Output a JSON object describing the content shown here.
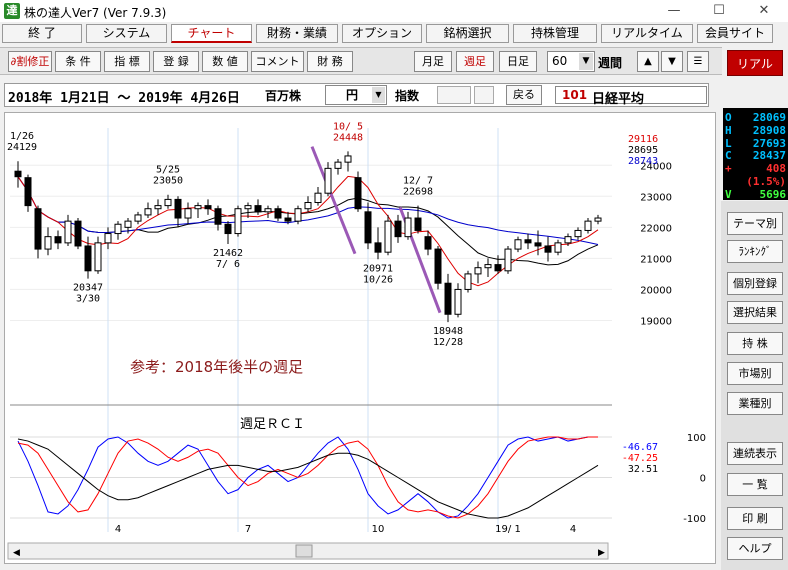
{
  "window": {
    "title": "株の達人Ver7 (Ver 7.9.3)",
    "icon_char": "達",
    "minimize": "—",
    "maximize": "☐",
    "close": "✕"
  },
  "menu": [
    "終 了",
    "システム",
    "チャート",
    "財務・業績",
    "オプション",
    "銘柄選択",
    "持株管理",
    "リアルタイム",
    "会員サイト"
  ],
  "menu_active": 2,
  "toolbar": {
    "left": [
      "∂割修正",
      "条 件",
      "指 標",
      "登 録",
      "数 値",
      "コメント",
      "財 務"
    ],
    "periods": [
      "月足",
      "週足",
      "日足"
    ],
    "period_active": 1,
    "count_value": "60",
    "count_unit": "週間",
    "up": "▲",
    "down": "▼",
    "menu": "☰"
  },
  "daterow": {
    "range": "2018年 1月21日 ～ 2019年 4月26日",
    "unit": "百万株",
    "currency": "円",
    "index_label": "指数",
    "back": "戻る",
    "code": "101",
    "name": "日経平均"
  },
  "right": {
    "real": "リアル",
    "ohlc": [
      {
        "k": "O",
        "v": "28069",
        "c": "#00c0ff"
      },
      {
        "k": "H",
        "v": "28908",
        "c": "#00c0ff"
      },
      {
        "k": "L",
        "v": "27693",
        "c": "#00c0ff"
      },
      {
        "k": "C",
        "v": "28437",
        "c": "#00c0ff"
      },
      {
        "k": "+",
        "v": "408",
        "c": "#ff3030"
      },
      {
        "k": " ",
        "v": "(1.5%)",
        "c": "#ff3030"
      },
      {
        "k": "V",
        "v": "5696",
        "c": "#40ff40"
      }
    ],
    "buttons": [
      "テーマ別",
      "ﾗﾝｷﾝｸﾞ",
      "個別登録",
      "選択結果",
      "持 株",
      "市場別",
      "業種別",
      "連続表示",
      "一 覧",
      "印 刷",
      "ヘルプ"
    ]
  },
  "colors": {
    "up_candle": "#ffffff",
    "down_candle": "#000000",
    "ma_red": "#dd0000",
    "ma_black": "#000000",
    "ma_blue": "#0000cc",
    "trend_line": "#9b59b6",
    "note_text": "#8b1a1a"
  },
  "chart_data": [
    {
      "type": "candlestick",
      "timeframe": "weekly",
      "ylim": [
        18500,
        25200
      ],
      "yticks": [
        19000,
        20000,
        21000,
        22000,
        23000,
        24000
      ],
      "xticks": [
        "4",
        "7",
        "10",
        "19/ 1",
        "4"
      ],
      "ma_values": [
        {
          "value": "29116",
          "color": "#dd0000"
        },
        {
          "value": "28695",
          "color": "#000000"
        },
        {
          "value": "28743",
          "color": "#0000cc"
        }
      ],
      "annotations": [
        {
          "label": "1/26",
          "value": "24129"
        },
        {
          "label": "3/30",
          "value": "20347"
        },
        {
          "label": "5/25",
          "value": "23050"
        },
        {
          "label": "7/ 6",
          "value": "21462"
        },
        {
          "label": "10/ 5",
          "value": "24448"
        },
        {
          "label": "10/26",
          "value": "20971"
        },
        {
          "label": "12/ 7",
          "value": "22698"
        },
        {
          "label": "12/28",
          "value": "18948"
        }
      ],
      "note": "参考：2018年後半の週足",
      "candles": [
        [
          23808,
          24129,
          23280,
          23631
        ],
        [
          23600,
          23700,
          22500,
          22700
        ],
        [
          22600,
          22700,
          21000,
          21300
        ],
        [
          21300,
          22000,
          21100,
          21700
        ],
        [
          21700,
          21900,
          21300,
          21500
        ],
        [
          21500,
          22400,
          21400,
          22200
        ],
        [
          22200,
          22300,
          21300,
          21400
        ],
        [
          21400,
          21700,
          20347,
          20600
        ],
        [
          20600,
          21700,
          20500,
          21500
        ],
        [
          21500,
          22000,
          21300,
          21800
        ],
        [
          21800,
          22200,
          21600,
          22100
        ],
        [
          22000,
          22300,
          21800,
          22200
        ],
        [
          22200,
          22500,
          22100,
          22400
        ],
        [
          22400,
          22800,
          22300,
          22600
        ],
        [
          22600,
          22900,
          22400,
          22700
        ],
        [
          22700,
          23050,
          22600,
          22900
        ],
        [
          22900,
          23000,
          22000,
          22300
        ],
        [
          22300,
          22800,
          22100,
          22600
        ],
        [
          22600,
          22800,
          22300,
          22700
        ],
        [
          22700,
          22900,
          22400,
          22600
        ],
        [
          22600,
          22700,
          21900,
          22100
        ],
        [
          22100,
          22200,
          21462,
          21800
        ],
        [
          21800,
          22700,
          21700,
          22600
        ],
        [
          22600,
          22800,
          22300,
          22700
        ],
        [
          22700,
          22900,
          22400,
          22500
        ],
        [
          22500,
          22700,
          22300,
          22600
        ],
        [
          22600,
          22700,
          22200,
          22300
        ],
        [
          22300,
          22500,
          22100,
          22200
        ],
        [
          22200,
          22700,
          22100,
          22600
        ],
        [
          22600,
          23000,
          22500,
          22800
        ],
        [
          22800,
          23300,
          22700,
          23100
        ],
        [
          23100,
          24100,
          23000,
          23900
        ],
        [
          23900,
          24200,
          23700,
          24100
        ],
        [
          24100,
          24448,
          23800,
          24300
        ],
        [
          23600,
          23800,
          22500,
          22600
        ],
        [
          22500,
          22800,
          21300,
          21500
        ],
        [
          21500,
          22000,
          20971,
          21200
        ],
        [
          21200,
          22400,
          21100,
          22200
        ],
        [
          22200,
          22400,
          21500,
          21700
        ],
        [
          21700,
          22500,
          21600,
          22300
        ],
        [
          22300,
          22698,
          21800,
          21900
        ],
        [
          21700,
          21900,
          21100,
          21300
        ],
        [
          21300,
          21400,
          20000,
          20200
        ],
        [
          20200,
          20500,
          18948,
          19200
        ],
        [
          19200,
          20200,
          19100,
          20000
        ],
        [
          20000,
          20600,
          19900,
          20500
        ],
        [
          20500,
          20900,
          20200,
          20700
        ],
        [
          20700,
          21000,
          20400,
          20800
        ],
        [
          20800,
          21100,
          20500,
          20600
        ],
        [
          20600,
          21400,
          20500,
          21300
        ],
        [
          21300,
          21700,
          21200,
          21600
        ],
        [
          21600,
          21800,
          21300,
          21500
        ],
        [
          21500,
          21900,
          21100,
          21400
        ],
        [
          21400,
          21700,
          20900,
          21200
        ],
        [
          21200,
          21600,
          21100,
          21500
        ],
        [
          21500,
          21800,
          21400,
          21700
        ],
        [
          21700,
          22000,
          21600,
          21900
        ],
        [
          21900,
          22300,
          21800,
          22200
        ],
        [
          22200,
          22400,
          22100,
          22300
        ]
      ]
    },
    {
      "type": "line",
      "title": "週足ＲＣＩ",
      "ylim": [
        -100,
        100
      ],
      "yticks": [
        100,
        0,
        -100
      ],
      "series": [
        {
          "color": "#0000ff",
          "last": "-46.67",
          "values": [
            90,
            40,
            -20,
            -85,
            -90,
            -70,
            -30,
            20,
            75,
            95,
            100,
            85,
            60,
            40,
            30,
            40,
            60,
            80,
            70,
            30,
            -10,
            -40,
            -30,
            0,
            20,
            30,
            10,
            -10,
            0,
            30,
            60,
            85,
            100,
            70,
            20,
            -40,
            -70,
            -90,
            -80,
            -60,
            -40,
            -60,
            -85,
            -100,
            -95,
            -70,
            -40,
            0,
            40,
            80,
            95,
            100,
            90,
            95,
            100,
            90,
            95,
            100,
            100
          ]
        },
        {
          "color": "#ff0000",
          "last": "-47.25",
          "values": [
            85,
            80,
            60,
            20,
            -20,
            -60,
            -85,
            -80,
            -40,
            10,
            60,
            90,
            95,
            85,
            70,
            50,
            40,
            50,
            65,
            70,
            60,
            30,
            0,
            -20,
            -10,
            10,
            20,
            10,
            0,
            10,
            30,
            55,
            75,
            85,
            90,
            70,
            30,
            -20,
            -60,
            -80,
            -85,
            -80,
            -85,
            -95,
            -100,
            -90,
            -70,
            -40,
            0,
            40,
            70,
            90,
            95,
            100,
            100,
            95,
            95,
            100,
            100
          ]
        },
        {
          "color": "#000000",
          "last": "32.51",
          "values": [
            95,
            90,
            80,
            70,
            50,
            30,
            10,
            -10,
            -30,
            -45,
            -55,
            -55,
            -50,
            -40,
            -30,
            -20,
            -10,
            0,
            10,
            20,
            25,
            30,
            30,
            25,
            20,
            15,
            15,
            20,
            25,
            35,
            45,
            55,
            60,
            60,
            55,
            45,
            30,
            15,
            0,
            -15,
            -30,
            -45,
            -60,
            -70,
            -80,
            -90,
            -95,
            -100,
            -100,
            -95,
            -85,
            -75,
            -60,
            -45,
            -30,
            -15,
            0,
            15,
            30
          ]
        }
      ]
    }
  ]
}
